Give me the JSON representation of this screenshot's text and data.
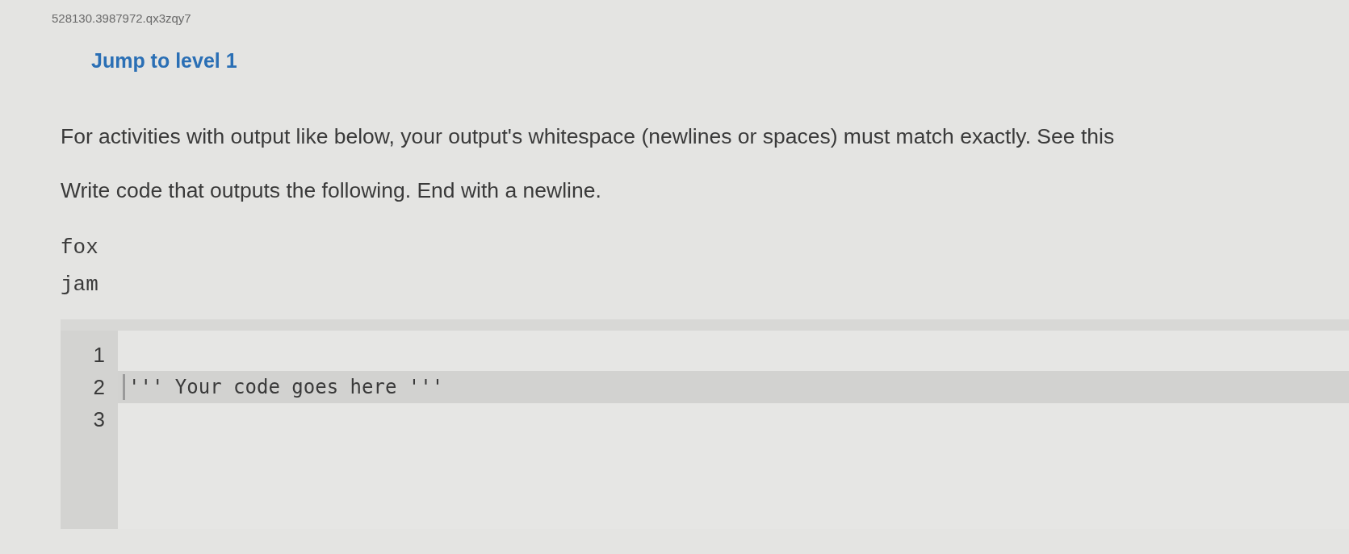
{
  "problem_id": "528130.3987972.qx3zqy7",
  "jump_link": "Jump to level 1",
  "instructions": [
    "For activities with output like below, your output's whitespace (newlines or spaces) must match exactly. See this",
    "Write code that outputs the following. End with a newline."
  ],
  "expected_output": [
    "fox",
    "jam"
  ],
  "editor": {
    "lines": [
      {
        "number": "1",
        "current": false
      },
      {
        "number": "2",
        "text": "''' Your code goes here '''",
        "current": true
      },
      {
        "number": "3",
        "current": false
      }
    ]
  }
}
